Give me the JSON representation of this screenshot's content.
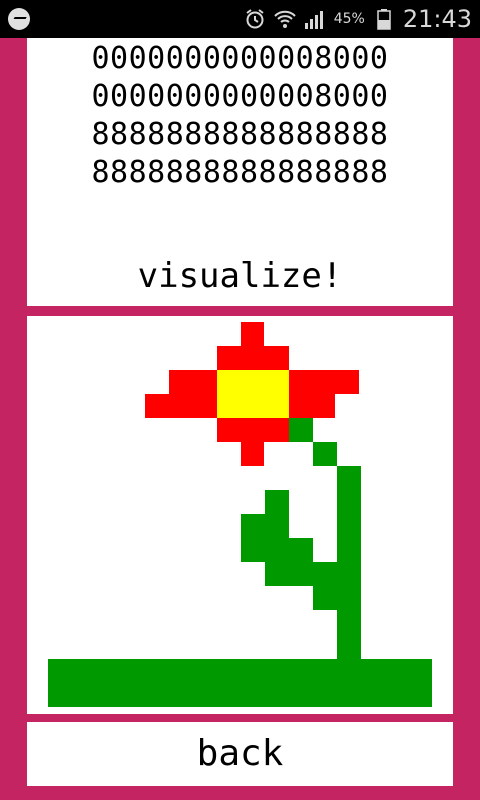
{
  "status_bar": {
    "notification_icon": "messenger-icon",
    "icons": [
      "alarm-icon",
      "wifi-icon",
      "signal-icon",
      "battery-icon"
    ],
    "battery_percent": "45%",
    "time": "21:43"
  },
  "code_rows": [
    "0000000000008000",
    "0000000000008000",
    "8888888888888888",
    "8888888888888888"
  ],
  "visualize_label": "visualize!",
  "back_label": "back",
  "colors": {
    "background": "#c42462",
    "panel": "#ffffff",
    "red": "#ff0000",
    "yellow": "#ffff00",
    "green": "#009900"
  }
}
